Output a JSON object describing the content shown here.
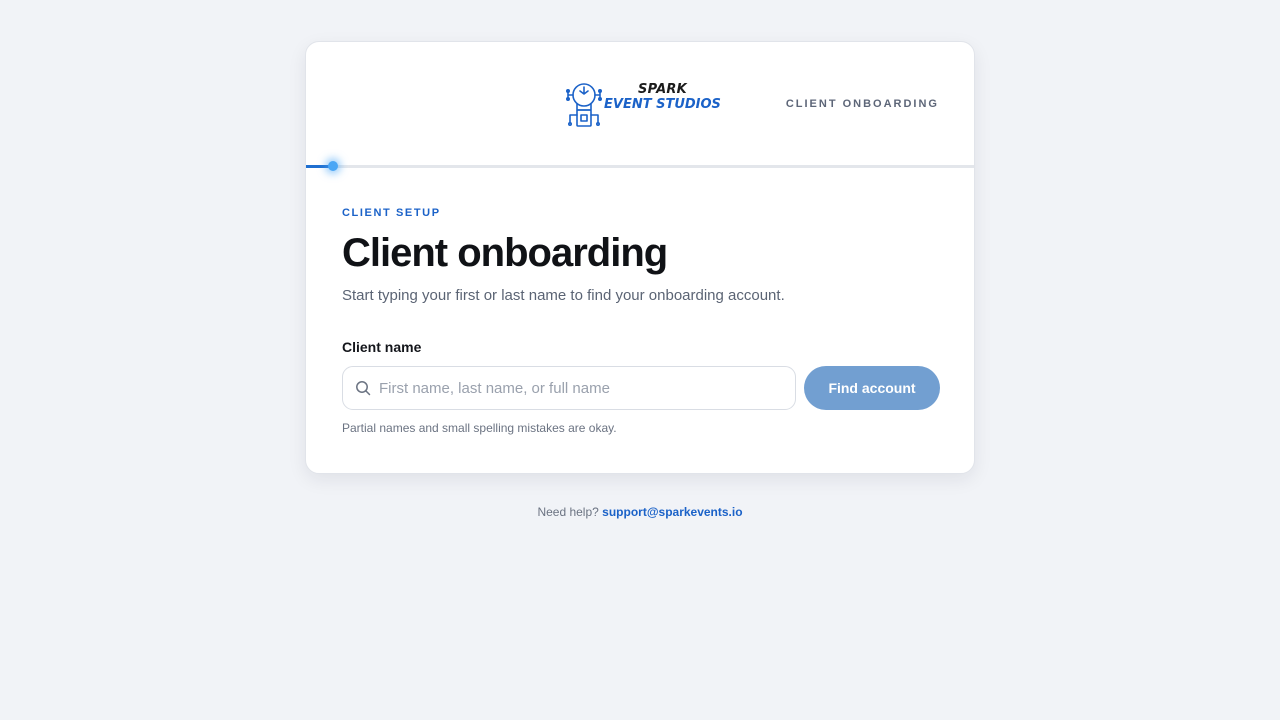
{
  "brand": {
    "logo_line1": "SPARK",
    "logo_line2": "EVENT STUDIOS",
    "logo_icon": "lightbulb-circuit-icon",
    "primary_color": "#1b62c8"
  },
  "header": {
    "tag": "CLIENT ONBOARDING"
  },
  "progress": {
    "fraction": 0.04,
    "fill_color": "#1f6fd0"
  },
  "main": {
    "eyebrow": "CLIENT SETUP",
    "title": "Client onboarding",
    "subtitle": "Start typing your first or last name to find your onboarding account."
  },
  "form": {
    "label": "Client name",
    "search": {
      "value": "",
      "placeholder": "First name, last name, or full name",
      "icon": "search-icon"
    },
    "submit_label": "Find account",
    "hint": "Partial names and small spelling mistakes are okay."
  },
  "footer": {
    "help_text": "Need help?",
    "email": "support@sparkevents.io"
  }
}
